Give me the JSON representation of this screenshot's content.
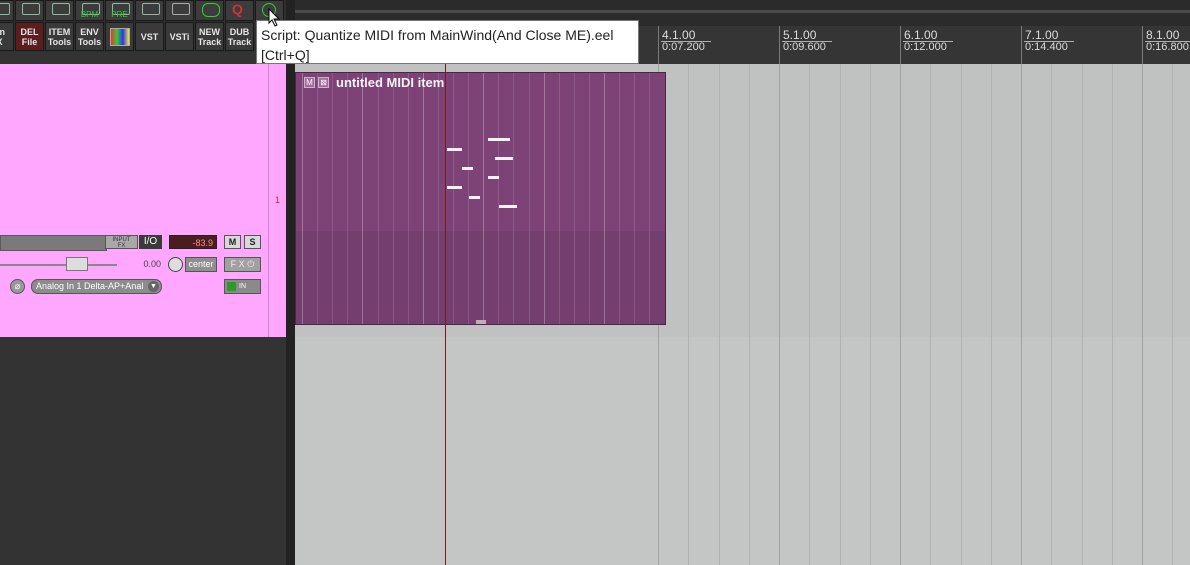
{
  "toolbar": {
    "top_row": [
      {
        "icon": "toolbar-icon-1"
      },
      {
        "icon": "hand-icon"
      },
      {
        "icon": "envelope-icon"
      },
      {
        "label": "BPM",
        "icon": "bpm-icon"
      },
      {
        "label": "PRE",
        "icon": "pre-roll-icon"
      },
      {
        "icon": "metronome-icon"
      },
      {
        "icon": "grid-icon"
      },
      {
        "icon": "loop-icon"
      },
      {
        "icon": "quantize-q-icon"
      },
      {
        "icon": "quantize-script-icon"
      }
    ],
    "bottom_row": [
      {
        "label": "on\nX"
      },
      {
        "label": "DEL\nFile"
      },
      {
        "label": "ITEM\nTools"
      },
      {
        "label": "ENV\nTools"
      },
      {
        "label": ""
      },
      {
        "label": "VST"
      },
      {
        "label": "VSTi"
      },
      {
        "label": "NEW\nTrack"
      },
      {
        "label": "DUB\nTrack"
      }
    ]
  },
  "tooltip": {
    "line1": "Script: Quantize MIDI from MainWind(And Close ME).eel",
    "line2": "[Ctrl+Q]"
  },
  "ruler": {
    "markers": [
      {
        "measure": "4.1.00",
        "time": "0:07.200"
      },
      {
        "measure": "5.1.00",
        "time": "0:09.600"
      },
      {
        "measure": "6.1.00",
        "time": "0:12.000"
      },
      {
        "measure": "7.1.00",
        "time": "0:14.400"
      },
      {
        "measure": "8.1.00",
        "time": "0:16.800"
      }
    ]
  },
  "track": {
    "number": "1",
    "input_fx_label": "INPUT\nFX",
    "io_label": "I/O",
    "meter_value": "-83.9",
    "mute_label": "M",
    "solo_label": "S",
    "volume_value": "0.00",
    "pan_label": "center",
    "fx_label": "F X",
    "input_select": "Analog In 1 Delta-AP+Anal",
    "monitor_label": "IN",
    "color": "#ffa6ff"
  },
  "midi_item": {
    "name": "untitled MIDI item",
    "color": "#7d4376",
    "notes": [
      {
        "pitch_row": 1,
        "start": 0.52,
        "len": 0.06
      },
      {
        "pitch_row": 2,
        "start": 0.41,
        "len": 0.04
      },
      {
        "pitch_row": 3,
        "start": 0.54,
        "len": 0.05
      },
      {
        "pitch_row": 4,
        "start": 0.45,
        "len": 0.03
      },
      {
        "pitch_row": 5,
        "start": 0.52,
        "len": 0.03
      },
      {
        "pitch_row": 6,
        "start": 0.41,
        "len": 0.04
      },
      {
        "pitch_row": 7,
        "start": 0.47,
        "len": 0.03
      },
      {
        "pitch_row": 8,
        "start": 0.55,
        "len": 0.05
      }
    ]
  }
}
